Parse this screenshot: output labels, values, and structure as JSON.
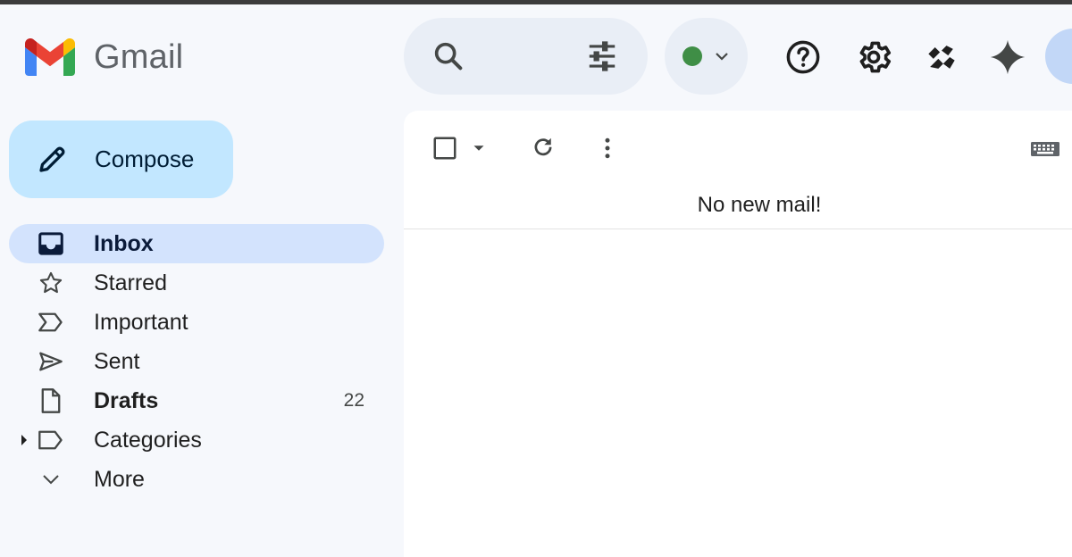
{
  "app": {
    "name": "Gmail"
  },
  "colors": {
    "sidebar_bg": "#f6f8fc",
    "search_bg": "#e9eef6",
    "compose_bg": "#c2e7ff",
    "active_nav_bg": "#d3e3fd",
    "status_online": "#3f8e46"
  },
  "header": {
    "search_icon": "search-icon",
    "filter_icon": "tune-icon",
    "status_icon": "status-dot-icon",
    "help_icon": "help-icon",
    "settings_icon": "gear-icon",
    "chat_icon": "chat-app-icon",
    "gemini_icon": "sparkle-icon"
  },
  "compose": {
    "label": "Compose",
    "icon": "pencil-icon"
  },
  "sidebar": {
    "items": [
      {
        "label": "Inbox",
        "icon": "inbox-icon",
        "active": true,
        "bold": true,
        "count": ""
      },
      {
        "label": "Starred",
        "icon": "star-icon",
        "active": false,
        "bold": false,
        "count": ""
      },
      {
        "label": "Important",
        "icon": "important-icon",
        "active": false,
        "bold": false,
        "count": ""
      },
      {
        "label": "Sent",
        "icon": "send-icon",
        "active": false,
        "bold": false,
        "count": ""
      },
      {
        "label": "Drafts",
        "icon": "draft-icon",
        "active": false,
        "bold": true,
        "count": "22"
      },
      {
        "label": "Categories",
        "icon": "label-icon",
        "active": false,
        "bold": false,
        "count": ""
      },
      {
        "label": "More",
        "icon": "chevron-down-icon",
        "active": false,
        "bold": false,
        "count": ""
      }
    ]
  },
  "main": {
    "empty_message": "No new mail!"
  }
}
